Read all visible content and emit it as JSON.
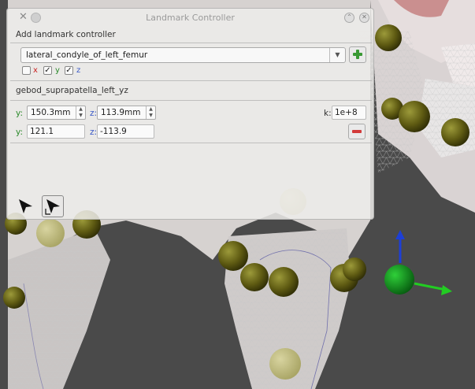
{
  "window": {
    "title": "Landmark Controller"
  },
  "section_add": {
    "label": "Add landmark controller"
  },
  "landmark_select": {
    "value": "lateral_condyle_of_left_femur"
  },
  "axes_filter": {
    "x_label": "x",
    "y_label": "y",
    "z_label": "z",
    "x_checked": false,
    "y_checked": true,
    "z_checked": true
  },
  "controller": {
    "name": "gebod_suprapatella_left_yz",
    "y_axis_label": "y:",
    "z_axis_label": "z:",
    "y_spin_value": "150.3mm",
    "z_spin_value": "113.9mm",
    "k_label": "k:",
    "k_value": "1e+8",
    "y_pos_label": "y:",
    "z_pos_label": "z:",
    "y_position": "121.1",
    "z_position": "-113.9"
  },
  "colors": {
    "accent_axis": "#3a7ec0",
    "add_green": "#3a9a35",
    "remove_red": "#d23a3a",
    "gizmo_y": "#1d3fd6",
    "gizmo_x": "#22cc22",
    "gizmo_center": "#0c8a17"
  },
  "icons": [
    "app-icon",
    "minimize-icon",
    "maximize-icon",
    "close-icon",
    "dropdown-arrow-icon",
    "add-icon",
    "remove-icon",
    "select-cursor-icon",
    "local-cursor-icon"
  ]
}
